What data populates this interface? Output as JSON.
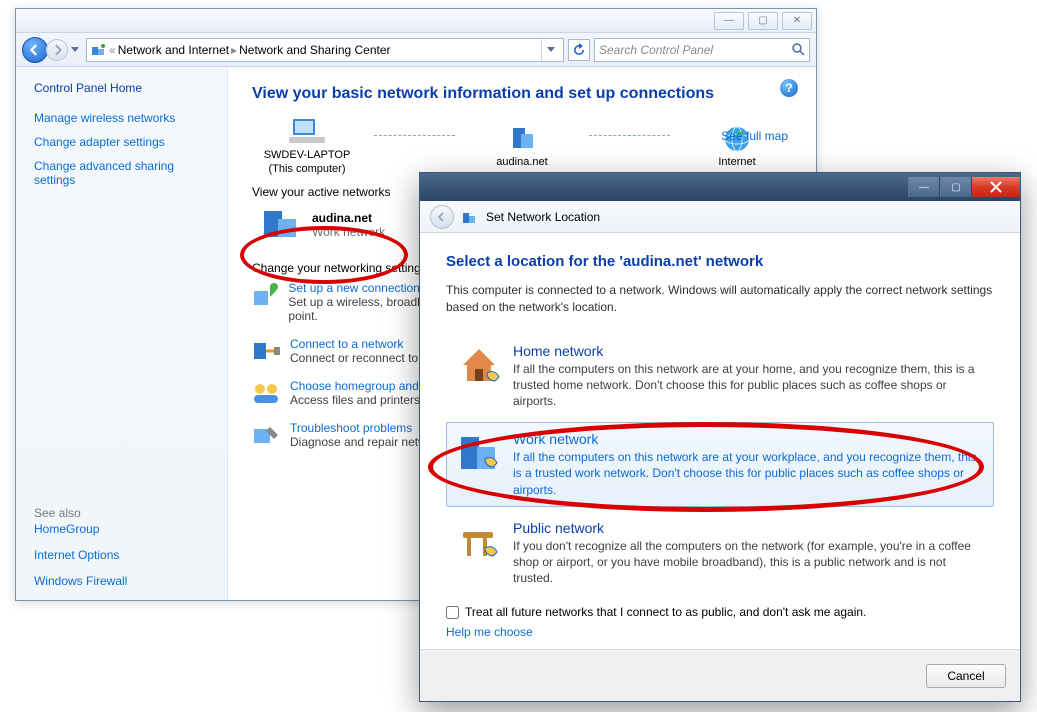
{
  "cpWindow": {
    "breadcrumb": {
      "prefix": "«",
      "part1": "Network and Internet",
      "part2": "Network and Sharing Center"
    },
    "searchPlaceholder": "Search Control Panel"
  },
  "sidebar": {
    "home": "Control Panel Home",
    "links": [
      "Manage wireless networks",
      "Change adapter settings",
      "Change advanced sharing settings"
    ],
    "seeAlso": "See also",
    "seeAlsoLinks": [
      "HomeGroup",
      "Internet Options",
      "Windows Firewall"
    ]
  },
  "main": {
    "heading": "View your basic network information and set up connections",
    "seeFullMap": "See full map",
    "nodes": {
      "thisPC": "SWDEV-LAPTOP",
      "thisPCsub": "(This computer)",
      "network": "audina.net",
      "internet": "Internet"
    },
    "viewActive": "View your active networks",
    "activeNet": {
      "name": "audina.net",
      "type": "Work network"
    },
    "changeSettings": "Change your networking settings",
    "tasks": [
      {
        "title": "Set up a new connection or network",
        "desc": "Set up a wireless, broadband, dial-up, ad-hoc, or VPN connection; or set up a router or access point."
      },
      {
        "title": "Connect to a network",
        "desc": "Connect or reconnect to a wireless, wired, dial-up, or VPN network connection."
      },
      {
        "title": "Choose homegroup and sharing options",
        "desc": "Access files and printers located on other network computers, or change sharing settings."
      },
      {
        "title": "Troubleshoot problems",
        "desc": "Diagnose and repair network problems, or get troubleshooting information."
      }
    ]
  },
  "dialog": {
    "title": "Set Network Location",
    "heading": "Select a location for the 'audina.net' network",
    "desc": "This computer is connected to a network. Windows will automatically apply the correct network settings based on the network's location.",
    "options": [
      {
        "title": "Home network",
        "desc": "If all the computers on this network are at your home, and you recognize them, this is a trusted home network.  Don't choose this for public places such as coffee shops or airports."
      },
      {
        "title": "Work network",
        "desc": "If all the computers on this network are at your workplace, and you recognize them, this is a trusted work network.  Don't choose this for public places such as coffee shops or airports."
      },
      {
        "title": "Public network",
        "desc": "If you don't recognize all the computers on the network (for example, you're in a coffee shop or airport, or you have mobile broadband), this is a public network and is not trusted."
      }
    ],
    "treatAll": "Treat all future networks that I connect to as public, and don't ask me again.",
    "helpMe": "Help me choose",
    "cancel": "Cancel"
  }
}
